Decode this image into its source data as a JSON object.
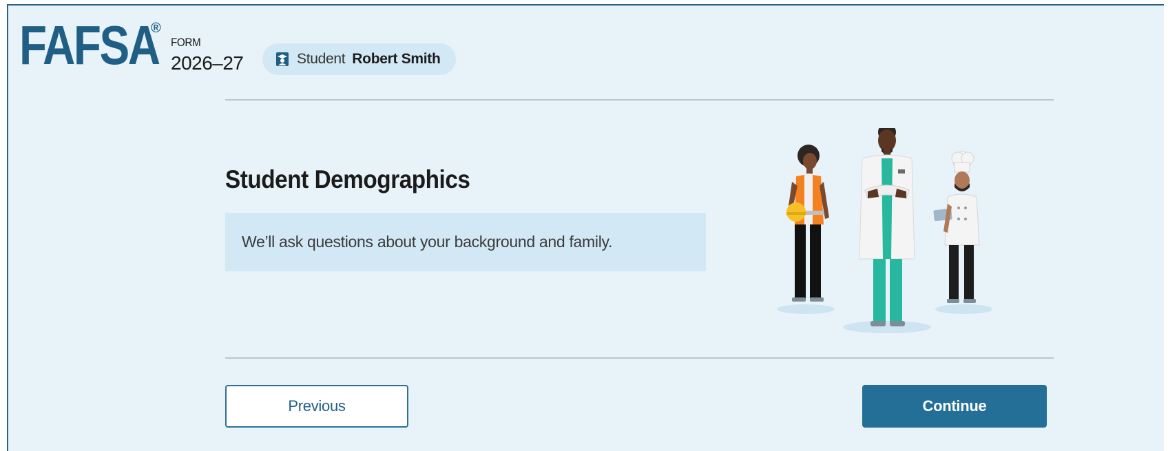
{
  "header": {
    "logo": "FAFSA",
    "logo_mark": "®",
    "form_label": "FORM",
    "form_year": "2026–27",
    "student_badge": {
      "icon": "graduate-icon",
      "role": "Student",
      "name": "Robert Smith"
    }
  },
  "main": {
    "title": "Student Demographics",
    "info": "We’ll ask questions about your background and family.",
    "illustration": "workers-illustration"
  },
  "footer": {
    "previous_label": "Previous",
    "continue_label": "Continue"
  },
  "colors": {
    "brand": "#205f85",
    "page_bg": "#e8f3f9",
    "info_bg": "#d3e8f5",
    "primary_button": "#236f98"
  }
}
